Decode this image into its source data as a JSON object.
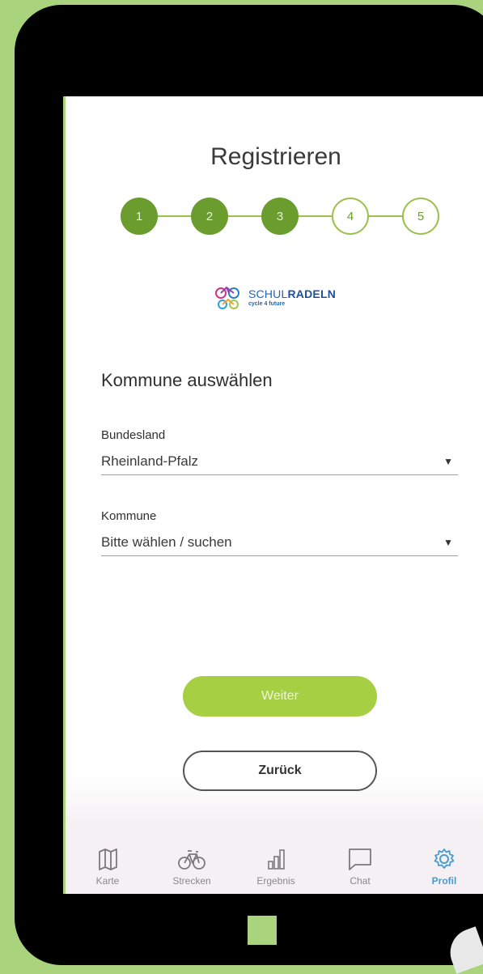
{
  "page": {
    "title": "Registrieren"
  },
  "stepper": {
    "steps": [
      {
        "label": "1",
        "state": "done"
      },
      {
        "label": "2",
        "state": "done"
      },
      {
        "label": "3",
        "state": "done"
      },
      {
        "label": "4",
        "state": "todo"
      },
      {
        "label": "5",
        "state": "todo"
      }
    ],
    "color_done": "#6a9c2e",
    "color_line": "#9bc14c"
  },
  "logo": {
    "brand_prefix": "SCHUL",
    "brand_suffix": "RADELN",
    "tagline": "cycle 4 future"
  },
  "section": {
    "title": "Kommune auswählen"
  },
  "fields": {
    "bundesland": {
      "label": "Bundesland",
      "value": "Rheinland-Pfalz",
      "caret": "▼"
    },
    "kommune": {
      "label": "Kommune",
      "value": "Bitte wählen / suchen",
      "caret": "▼"
    }
  },
  "buttons": {
    "next_label": "Weiter",
    "back_label": "Zurück",
    "primary_color": "#a6cf43"
  },
  "tabbar": {
    "items": [
      {
        "label": "Karte",
        "icon": "map-icon",
        "active": false
      },
      {
        "label": "Strecken",
        "icon": "bicycle-icon",
        "active": false
      },
      {
        "label": "Ergebnis",
        "icon": "bar-chart-icon",
        "active": false
      },
      {
        "label": "Chat",
        "icon": "chat-icon",
        "active": false
      },
      {
        "label": "Profil",
        "icon": "gear-icon",
        "active": true
      }
    ],
    "active_color": "#4a9ccf"
  },
  "theme": {
    "background": "#a9d37d"
  }
}
